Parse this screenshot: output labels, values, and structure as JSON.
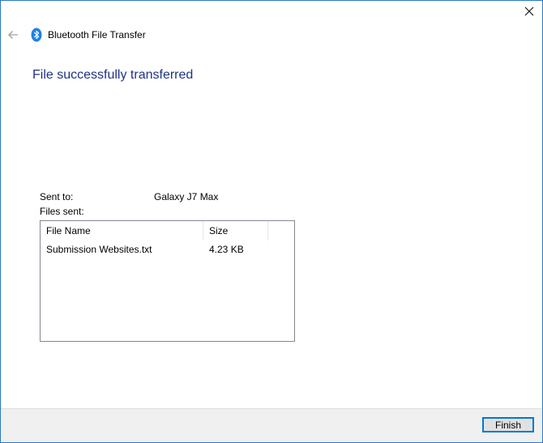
{
  "window": {
    "title": "Bluetooth File Transfer"
  },
  "icons": {
    "close": "close-icon",
    "back": "back-arrow-icon",
    "bluetooth": "bluetooth-icon"
  },
  "main": {
    "heading": "File successfully transferred",
    "sent_to_label": "Sent to:",
    "sent_to_value": "Galaxy J7 Max",
    "files_sent_label": "Files sent:"
  },
  "file_list": {
    "columns": [
      "File Name",
      "Size"
    ],
    "rows": [
      {
        "name": "Submission Websites.txt",
        "size": "4.23 KB"
      }
    ]
  },
  "footer": {
    "finish_label": "Finish"
  },
  "colors": {
    "accent": "#0078d7",
    "heading": "#1e3287",
    "window_border": "#2b79c2"
  }
}
